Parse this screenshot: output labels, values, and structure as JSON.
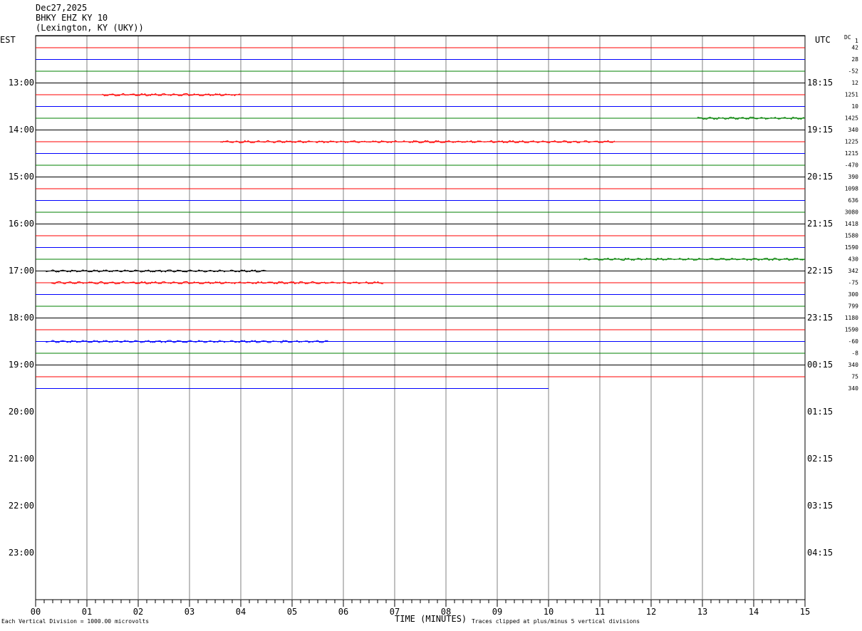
{
  "header": {
    "date": "Dec27,2025",
    "station": "BHKY EHZ KY 10",
    "location": "(Lexington, KY (UKY))"
  },
  "corners": {
    "left_tz": "EST",
    "right_tz": "UTC",
    "dc_label": "DC"
  },
  "footer": {
    "left": "Each Vertical Division = 1000.00 microvolts",
    "center": "TIME (MINUTES)",
    "right": "Traces clipped at plus/minus 5 vertical divisions"
  },
  "colors": {
    "black": "#000000",
    "red": "#ff0000",
    "blue": "#0000ff",
    "green": "#008000",
    "grid": "#808080"
  },
  "chart_data": {
    "type": "line",
    "title": "BHKY EHZ KY 10",
    "xlabel": "TIME (MINUTES)",
    "xlim": [
      0,
      15
    ],
    "x_ticks": [
      "00",
      "01",
      "02",
      "03",
      "04",
      "05",
      "06",
      "07",
      "08",
      "09",
      "10",
      "11",
      "12",
      "13",
      "14",
      "15"
    ],
    "left_hour_labels": [
      "13:00",
      "14:00",
      "15:00",
      "16:00",
      "17:00",
      "18:00",
      "19:00",
      "20:00",
      "21:00",
      "22:00",
      "23:00"
    ],
    "right_hour_labels": [
      "18:15",
      "19:15",
      "20:15",
      "21:15",
      "22:15",
      "23:15",
      "00:15",
      "01:15",
      "02:15",
      "03:15",
      "04:15"
    ],
    "dc_first": "1",
    "dc_offsets": [
      "42",
      "28",
      "-52",
      "12",
      "1251",
      "10",
      "1425",
      "340",
      "1225",
      "1215",
      "-470",
      "390",
      "1098",
      "636",
      "3080",
      "1418",
      "1580",
      "1590",
      "430",
      "342",
      "-75",
      "300",
      "799",
      "1180",
      "1590",
      "-60",
      "-8",
      "340",
      "75",
      "340"
    ],
    "trace_colors": [
      "black",
      "red",
      "blue",
      "green"
    ],
    "traces_start_minute": 0,
    "traces_end_minute": 10.0,
    "trace_count": 31
  }
}
